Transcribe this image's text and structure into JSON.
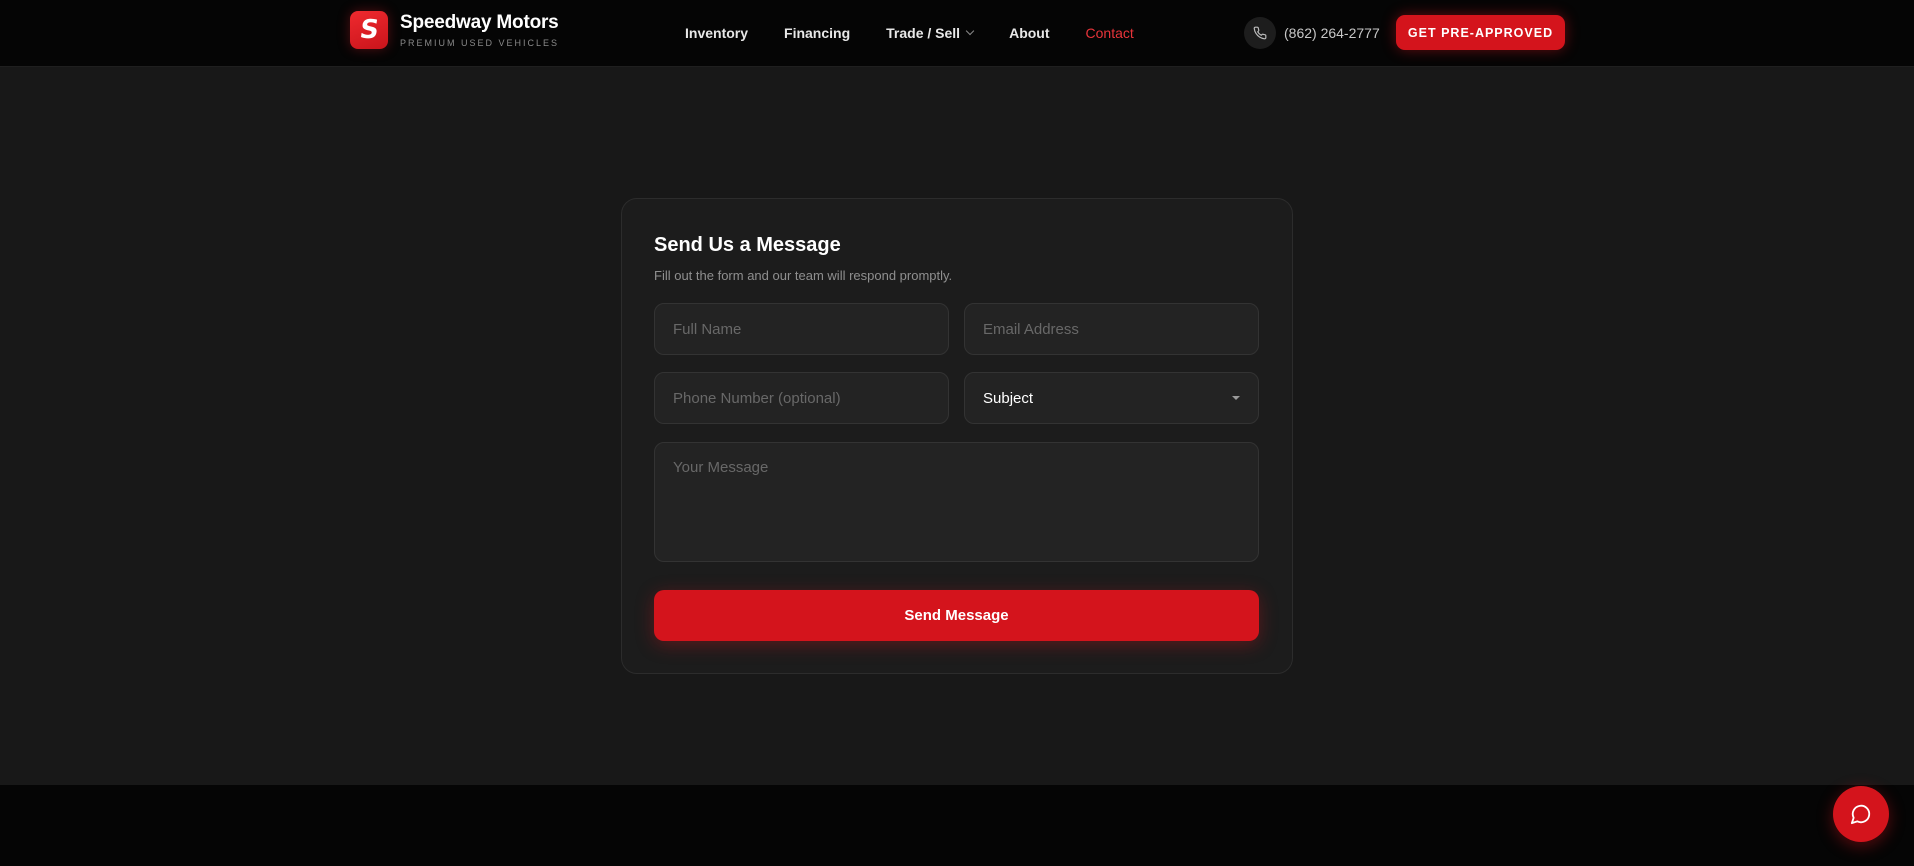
{
  "brand": {
    "logo_letter": "S",
    "name": "Speedway Motors",
    "tagline": "PREMIUM USED VEHICLES"
  },
  "nav": {
    "items": [
      {
        "label": "Inventory"
      },
      {
        "label": "Financing"
      },
      {
        "label": "Trade / Sell"
      },
      {
        "label": "About"
      },
      {
        "label": "Contact"
      }
    ]
  },
  "header": {
    "phone": "(862) 264-2777",
    "cta_label": "GET PRE-APPROVED"
  },
  "form": {
    "title": "Send Us a Message",
    "subtitle": "Fill out the form and our team will respond promptly.",
    "name_placeholder": "Full Name",
    "email_placeholder": "Email Address",
    "phone_placeholder": "Phone Number (optional)",
    "subject_selected": "Subject",
    "message_placeholder": "Your Message",
    "submit_label": "Send Message"
  },
  "colors": {
    "accent": "#d4141c",
    "active_link": "#e8343a",
    "background": "#181818",
    "header_bg": "#050505"
  },
  "icons": {
    "phone": "phone-icon",
    "chat": "chat-bubble-icon",
    "dropdown": "chevron-down-icon"
  }
}
